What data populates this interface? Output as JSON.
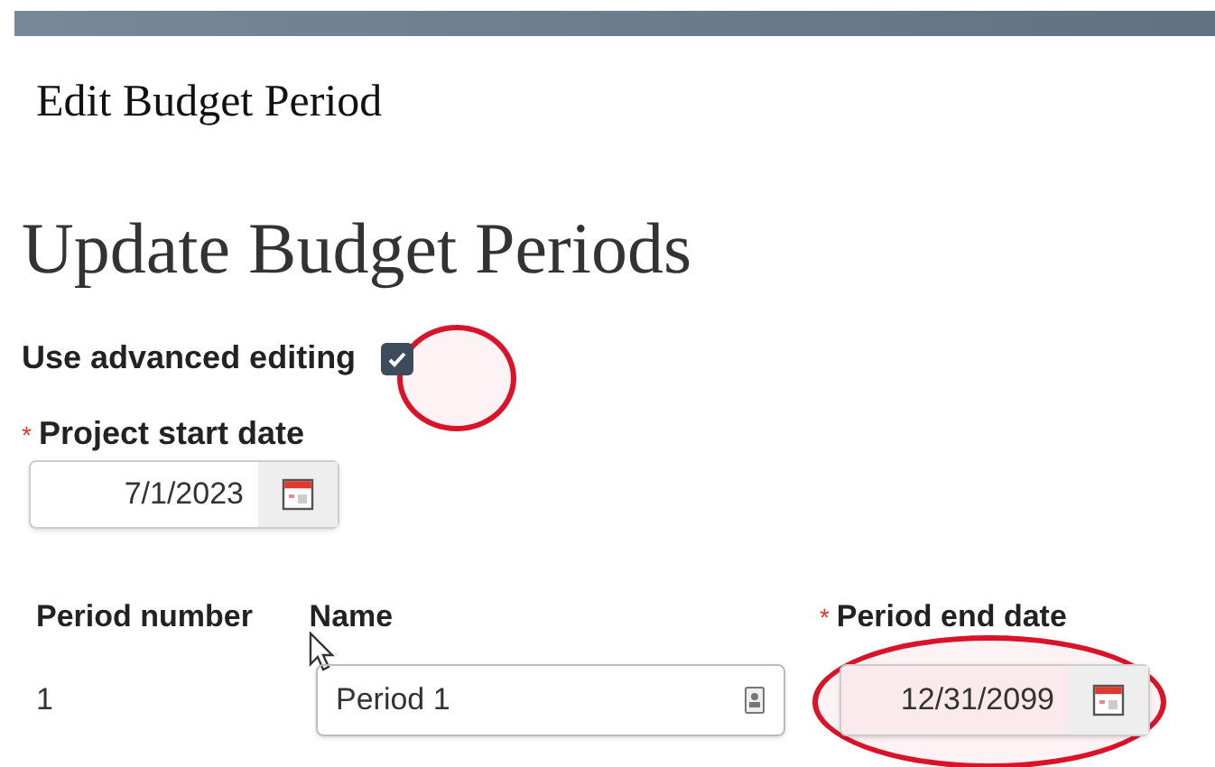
{
  "dialog": {
    "title": "Edit Budget Period"
  },
  "heading": "Update Budget Periods",
  "advanced_editing": {
    "label": "Use advanced editing",
    "checked": true,
    "highlighted": true
  },
  "project_start_date": {
    "label": "Project start date",
    "required": true,
    "required_mark": "*",
    "value": "7/1/2023"
  },
  "table": {
    "columns": [
      {
        "label": "Period number",
        "required": false
      },
      {
        "label": "Name",
        "required": false
      },
      {
        "label": "Period end date",
        "required": true,
        "required_mark": "*"
      }
    ],
    "rows": [
      {
        "number": "1",
        "name": "Period 1",
        "end_date": "12/31/2099",
        "end_date_highlighted": true
      }
    ]
  }
}
